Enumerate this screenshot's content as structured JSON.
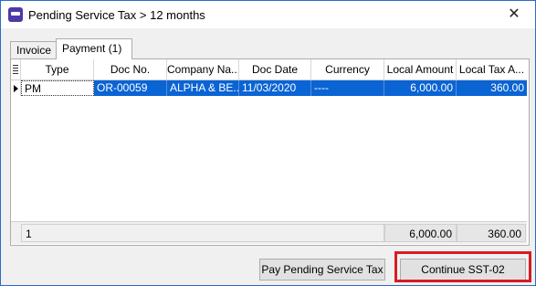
{
  "window": {
    "title": "Pending Service Tax > 12 months",
    "close_glyph": "✕"
  },
  "tabs": [
    {
      "label": "Invoice",
      "active": false
    },
    {
      "label": "Payment (1)",
      "active": true
    }
  ],
  "grid": {
    "columns": [
      "Type",
      "Doc No.",
      "Company Na...",
      "Doc Date",
      "Currency",
      "Local Amount",
      "Local Tax A..."
    ],
    "rows": [
      {
        "type": "PM",
        "doc_no": "OR-00059",
        "company": "ALPHA & BE...",
        "doc_date": "11/03/2020",
        "currency": "----",
        "local_amount": "6,000.00",
        "local_tax": "360.00"
      }
    ],
    "footer": {
      "count": "1",
      "local_amount_total": "6,000.00",
      "local_tax_total": "360.00"
    }
  },
  "buttons": {
    "pay_pending": "Pay Pending Service Tax",
    "continue": "Continue SST-02"
  },
  "colors": {
    "selection": "#0a64d4",
    "highlight_box": "#d81c24"
  }
}
